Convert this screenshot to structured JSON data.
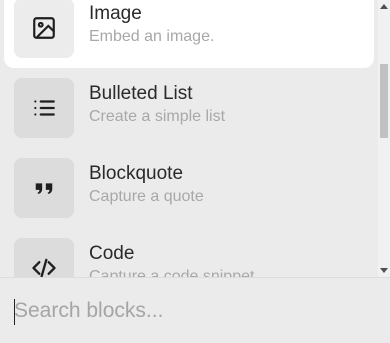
{
  "blocks": {
    "items": [
      {
        "title": "Image",
        "description": "Embed an image.",
        "icon": "image-icon"
      },
      {
        "title": "Bulleted List",
        "description": "Create a simple list",
        "icon": "bulleted-list-icon"
      },
      {
        "title": "Blockquote",
        "description": "Capture a quote",
        "icon": "quote-icon"
      },
      {
        "title": "Code",
        "description": "Capture a code snippet",
        "icon": "code-icon"
      }
    ],
    "selected_index": 0
  },
  "search": {
    "placeholder": "Search blocks...",
    "value": ""
  },
  "colors": {
    "panel_bg": "#ebebeb",
    "selected_bg": "#ffffff",
    "icon_tile_bg": "#dcdcdc",
    "title_text": "#2a2a2a",
    "description_text": "#a8a8a8",
    "scroll_thumb": "#c1c1c1"
  }
}
